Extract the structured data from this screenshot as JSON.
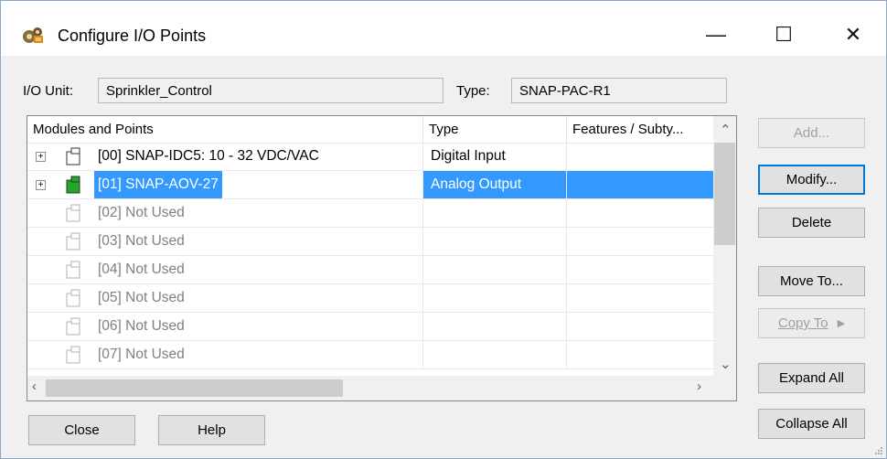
{
  "window": {
    "title": "Configure I/O Points"
  },
  "title_controls": {
    "minimize": "—",
    "maximize": "☐",
    "close": "✕"
  },
  "io_unit": {
    "label": "I/O Unit:",
    "value": "Sprinkler_Control"
  },
  "type_field": {
    "label": "Type:",
    "value": "SNAP-PAC-R1"
  },
  "list": {
    "columns": [
      "Modules and Points",
      "Type",
      "Features / Subty..."
    ],
    "rows": [
      {
        "name": "[00] SNAP-IDC5: 10 - 32 VDC/VAC",
        "type": "Digital Input",
        "features": "",
        "expandable": true,
        "used": true,
        "selected": false
      },
      {
        "name": "[01] SNAP-AOV-27",
        "type": "Analog Output",
        "features": "",
        "expandable": true,
        "used": true,
        "selected": true
      },
      {
        "name": "[02] Not Used",
        "type": "",
        "features": "",
        "expandable": false,
        "used": false,
        "selected": false
      },
      {
        "name": "[03] Not Used",
        "type": "",
        "features": "",
        "expandable": false,
        "used": false,
        "selected": false
      },
      {
        "name": "[04] Not Used",
        "type": "",
        "features": "",
        "expandable": false,
        "used": false,
        "selected": false
      },
      {
        "name": "[05] Not Used",
        "type": "",
        "features": "",
        "expandable": false,
        "used": false,
        "selected": false
      },
      {
        "name": "[06] Not Used",
        "type": "",
        "features": "",
        "expandable": false,
        "used": false,
        "selected": false
      },
      {
        "name": "[07] Not Used",
        "type": "",
        "features": "",
        "expandable": false,
        "used": false,
        "selected": false
      }
    ],
    "expander_symbol": "+"
  },
  "buttons": {
    "add": "Add...",
    "modify": "Modify...",
    "delete": "Delete",
    "move_to": "Move To...",
    "copy_to": "Copy To",
    "expand_all": "Expand All",
    "collapse_all": "Collapse All",
    "close": "Close",
    "help": "Help"
  },
  "colors": {
    "selection": "#3399ff",
    "module_green": "#22a822",
    "default_border": "#0078d7"
  }
}
